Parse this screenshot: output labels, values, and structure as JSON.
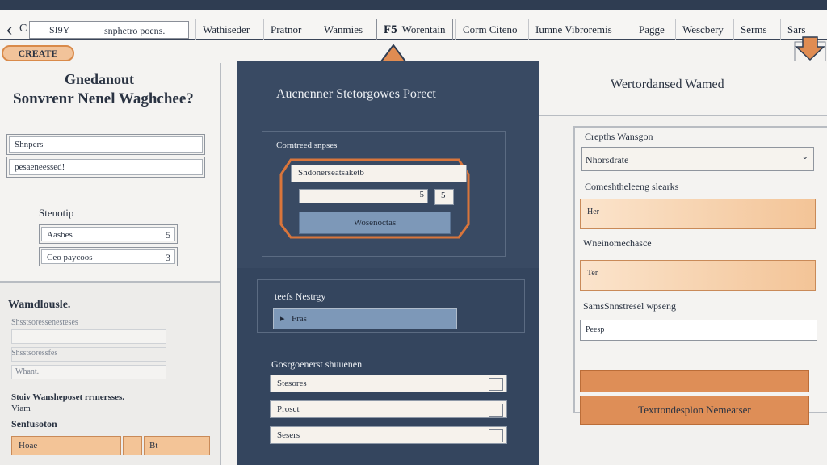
{
  "browser": {
    "back_glyph": "‹",
    "nav_text": "C",
    "address_short": "SI9Y",
    "address_text": "snphetro poens."
  },
  "tabs": [
    {
      "label": "Wathiseder"
    },
    {
      "label": "Pratnor"
    },
    {
      "label": "Wanmies"
    },
    {
      "label": "Worentain",
      "icon": "F5"
    },
    {
      "label": "Corm Citeno"
    },
    {
      "label": "Iumne Vibroremis"
    },
    {
      "label": "Pagge"
    },
    {
      "label": "Wescbery"
    },
    {
      "label": "Serms"
    },
    {
      "label": "Sars"
    }
  ],
  "create_badge": "CREATE",
  "left": {
    "title_line1": "Gnedanout",
    "title_line2": "Sonvrenr Nenel Waghchee?",
    "field1": "Shnpers",
    "field2": "pesaeneessed!",
    "section1_title": "Stenotip",
    "field3": "Aasbes",
    "field3_tail": "5",
    "field4": "Ceo paycoos",
    "field4_tail": "3",
    "section2_title": "Wamdlousle.",
    "ghost_label1": "Shsstsoressenesteses",
    "ghost_label2": "Shsstsoressfes",
    "ghost_value": "Whant.",
    "note_line1": "Stoiv Wansheposet rrmersses.",
    "note_line2": "Viam",
    "section3_title": "Senfusoton",
    "btn1_label": "Hoae",
    "btn2_label": "Bt"
  },
  "center": {
    "header": "Aucnenner Stetorgowes Porect",
    "group1_title": "Corntreed snpses",
    "highlight_label": "Shdonerseatsaketb",
    "btn_label": "Wosenoctas",
    "group2_title": "teefs Nestrgy",
    "select_value": "Fras",
    "group3_title": "Gosrgoenerst shuuenen",
    "rows": [
      "Stesores",
      "Prosct",
      "Sesers"
    ]
  },
  "right": {
    "header": "Wertordansed Wamed",
    "label1": "Crepths Wansgon",
    "select1": "Nhorsdrate",
    "label2": "Comeshtheleeng slearks",
    "input2": "Her",
    "label3": "Wneinomechasce",
    "input3": "Ter",
    "label4": "SamsSnnstresel wpseng",
    "input4": "Peesp",
    "button_main": "Texrtondesplon Nemeatser"
  },
  "colors": {
    "navy": "#34455e",
    "accent_orange": "#de8e57",
    "peach": "#f3c497",
    "steel_blue": "#7d98b8"
  }
}
